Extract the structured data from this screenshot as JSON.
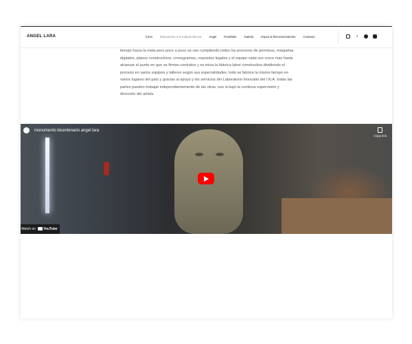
{
  "brand": "ANGEL LARA",
  "nav": [
    "Inicio",
    "Monumento a la Independencia",
    "Angel",
    "Portafolio",
    "Galeria",
    "Expos & Reconocimientos",
    "Contacto"
  ],
  "nav_active_index": 1,
  "social_icons": [
    "instagram-icon",
    "tiktok-icon",
    "facebook-icon",
    "youtube-icon"
  ],
  "paragraph": "tiempo hacia la meta pero poco a poco se van cumpliendo todos los procesos de permisos, maquetas digitales, planos constructivos, cronogramas, requisitos legales y el equipo cada vez crece mas hasta alcanzar el punto en que se firman contratos y se inicia la titánica labor constructiva dividiendo el proceso en varios equipos y talleres según sus especialidades, todo se fabrica la mismo tiempo en varios lugares del país y gracias al apoyo y los servicios del Laboratorio Innovatio del I.N.A. todas las partes pueden trabajar independientemente de las otras, eso si bajo la continua supervisión y dirección del artista.",
  "video": {
    "title": "monumento bicentenario angel lara",
    "copy_link": "Copy link",
    "watch_on": "Watch on",
    "youtube": "YouTube"
  },
  "colors": {
    "accent": "#ff0000",
    "text": "#555555"
  }
}
